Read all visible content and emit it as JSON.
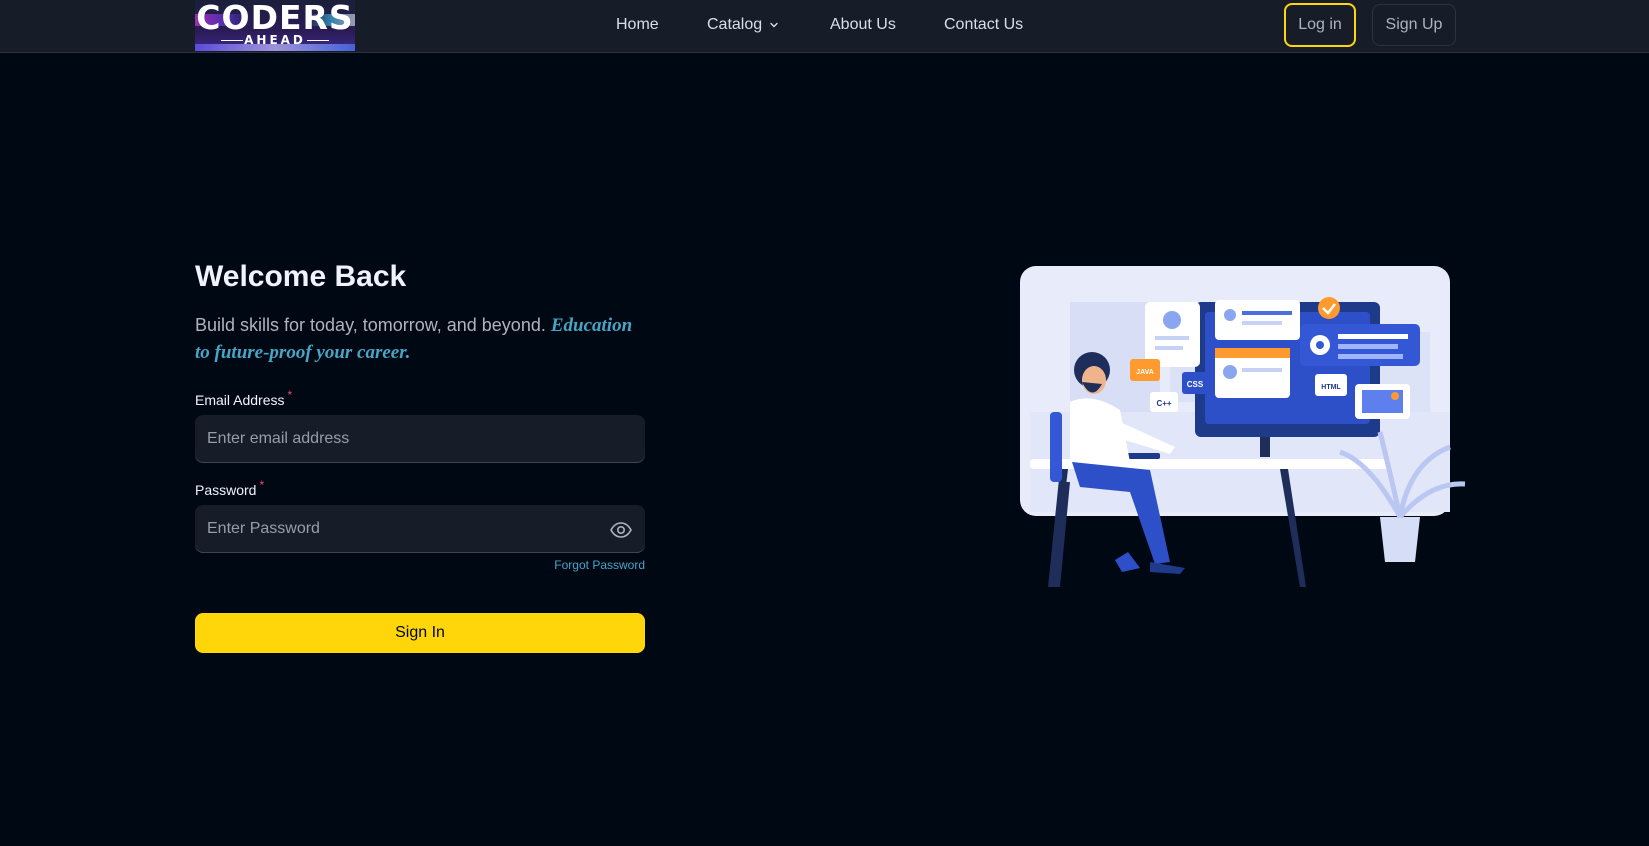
{
  "logo": {
    "main": "CODERS",
    "sub": "AHEAD"
  },
  "nav": {
    "home": "Home",
    "catalog": "Catalog",
    "about": "About Us",
    "contact": "Contact Us"
  },
  "auth": {
    "login": "Log in",
    "signup": "Sign Up"
  },
  "form": {
    "title": "Welcome Back",
    "subtitle": "Build skills for today, tomorrow, and beyond.",
    "subtitle_highlight": "Education to future-proof your career.",
    "email_label": "Email Address",
    "email_placeholder": "Enter email address",
    "password_label": "Password",
    "password_placeholder": "Enter Password",
    "required_mark": "*",
    "forgot": "Forgot Password",
    "submit": "Sign In"
  },
  "illustration": {
    "tags": [
      "JAVA",
      "CSS",
      "C++",
      "HTML"
    ]
  },
  "colors": {
    "background": "#000814",
    "navbar": "#161d29",
    "accent": "#ffd60a",
    "link": "#47a5c5",
    "required": "#ef476f"
  }
}
